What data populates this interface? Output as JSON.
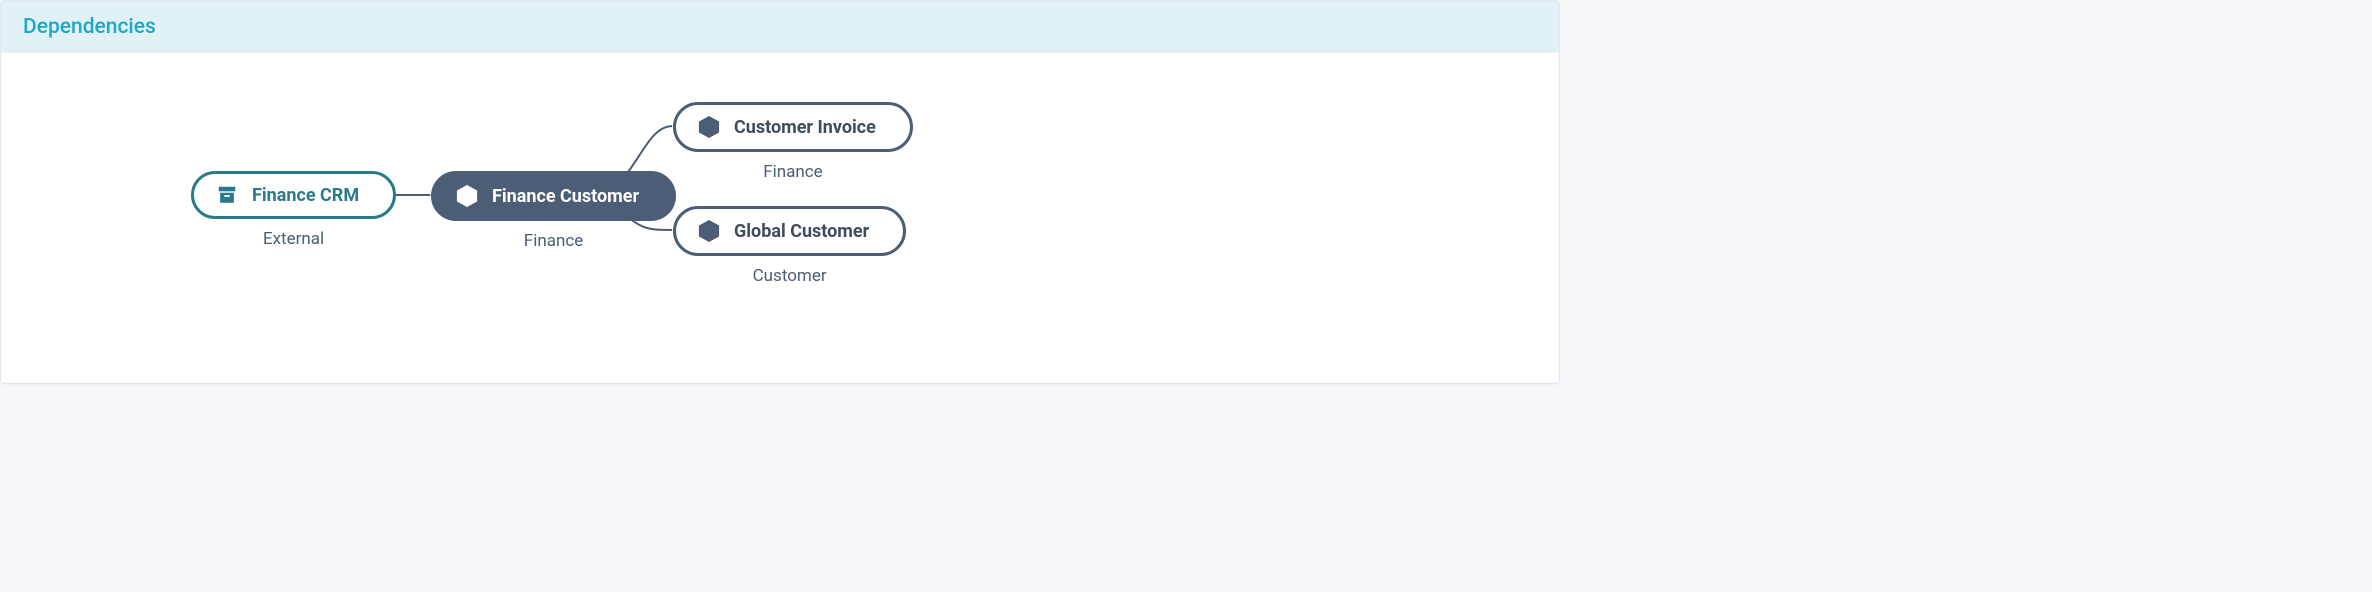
{
  "panel": {
    "title": "Dependencies"
  },
  "nodes": {
    "source": {
      "label": "Finance CRM",
      "sublabel": "External"
    },
    "center": {
      "label": "Finance Customer",
      "sublabel": "Finance"
    },
    "target1": {
      "label": "Customer Invoice",
      "sublabel": "Finance"
    },
    "target2": {
      "label": "Global Customer",
      "sublabel": "Customer"
    }
  },
  "colors": {
    "teal": "#2B7A8C",
    "slate": "#4B5E76",
    "headerBg": "#E2F1F6",
    "headerText": "#1BA9C8"
  }
}
